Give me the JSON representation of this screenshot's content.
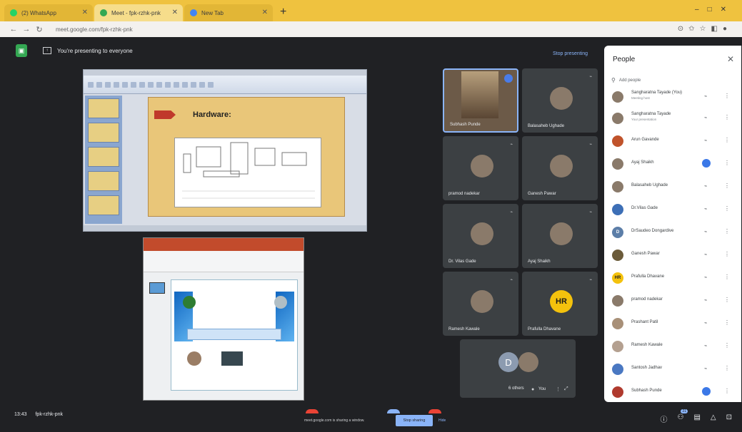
{
  "browser": {
    "tabs": [
      {
        "label": "(2) WhatsApp",
        "color": "#25d366"
      },
      {
        "label": "Meet - fpk-rzhk-pnk",
        "color": "#34a853"
      },
      {
        "label": "New Tab",
        "color": "#4285f4"
      }
    ],
    "url": "meet.google.com/fpk-rzhk-pnk"
  },
  "meet": {
    "presenting_text": "You're presenting to everyone",
    "stop_presenting": "Stop presenting",
    "slide1": {
      "heading": "Hardware:"
    },
    "tiles": [
      {
        "name": "Subhash Punde",
        "initials": ""
      },
      {
        "name": "Balasaheb Ughade",
        "initials": ""
      },
      {
        "name": "pramod nadekar",
        "initials": ""
      },
      {
        "name": "Ganesh Pawar",
        "initials": ""
      },
      {
        "name": "Dr. Vilas Gade",
        "initials": ""
      },
      {
        "name": "Ayaj Shaikh",
        "initials": ""
      },
      {
        "name": "Ramesh Kawale",
        "initials": ""
      },
      {
        "name": "Prafulla Dhavane",
        "initials": "HR"
      }
    ],
    "others": {
      "initial": "D",
      "label": "6 others",
      "you": "You"
    }
  },
  "people_panel": {
    "title": "People",
    "add_people": "Add people",
    "participants": [
      {
        "name": "Sangharatna Tayade (You)",
        "sub": "Meeting host",
        "initials": ""
      },
      {
        "name": "Sangharatna Tayade",
        "sub": "Your presentation",
        "initials": ""
      },
      {
        "name": "Arun Gavande",
        "sub": "",
        "initials": ""
      },
      {
        "name": "Ayaj Shaikh",
        "sub": "",
        "initials": "",
        "speaking": true
      },
      {
        "name": "Balasaheb Ughade",
        "sub": "",
        "initials": ""
      },
      {
        "name": "Dr.Vilas Gade",
        "sub": "",
        "initials": ""
      },
      {
        "name": "DrSaudeo Dongardive",
        "sub": "",
        "initials": "D"
      },
      {
        "name": "Ganesh Pawar",
        "sub": "",
        "initials": ""
      },
      {
        "name": "Prafulla Dhavane",
        "sub": "",
        "initials": "HR"
      },
      {
        "name": "pramod nadekar",
        "sub": "",
        "initials": ""
      },
      {
        "name": "Prashant Patil",
        "sub": "",
        "initials": ""
      },
      {
        "name": "Ramesh Kawale",
        "sub": "",
        "initials": ""
      },
      {
        "name": "Santosh Jadhav",
        "sub": "",
        "initials": ""
      },
      {
        "name": "Subhash Punde",
        "sub": "",
        "initials": "",
        "speaking": true
      }
    ]
  },
  "bottom_bar": {
    "time": "13:43",
    "meeting_code": "fpk-rzhk-pnk",
    "share_message": "meet.google.com is sharing a window.",
    "stop_sharing": "Stop sharing",
    "hide": "Hide",
    "participant_count": "21"
  },
  "colors": {
    "accent": "#8ab4f8",
    "meet_bg": "#202124",
    "tab_bar": "#efc23f"
  }
}
